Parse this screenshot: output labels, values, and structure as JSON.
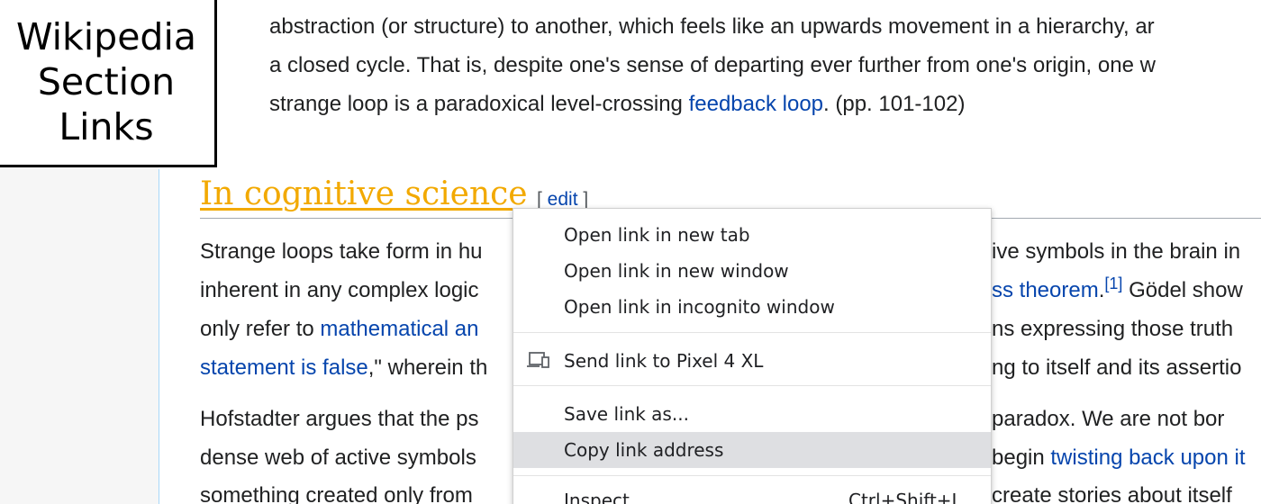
{
  "badge": {
    "line1": "Wikipedia",
    "line2": "Section",
    "line3": "Links"
  },
  "intro": {
    "line1": "abstraction (or structure) to another, which feels like an upwards movement in a hierarchy, ar",
    "line2": "a closed cycle. That is, despite one's sense of departing ever further from one's origin, one w",
    "line3_a": "strange loop is a paradoxical level-crossing ",
    "line3_link": "feedback loop",
    "line3_b": ". (pp. 101-102)"
  },
  "section": {
    "heading": "In cognitive science",
    "edit_open": "[ ",
    "edit_label": "edit",
    "edit_close": " ]"
  },
  "para1": {
    "l1a": "Strange loops take form in hu",
    "l1b": "ive symbols in the brain in",
    "l2a": "inherent in any complex logic",
    "l2link": "ss theorem",
    "l2dot": ".",
    "l2sup": "[1]",
    "l2c": " Gödel show",
    "l3a": "only refer to ",
    "l3link": "mathematical an",
    "l3b": "ns expressing those truth",
    "l4link": "statement is false",
    "l4a": ",\" wherein th",
    "l4b": "ng to itself and its assertio"
  },
  "para2": {
    "l1a": "Hofstadter argues that the ps",
    "l1b": " paradox. We are not bor",
    "l2a": "dense web of active symbols",
    "l2b": "begin ",
    "l2link": "twisting back upon it",
    "l3a": "something created only from ",
    "l3b": "create stories about itself"
  },
  "context_menu": {
    "open_new_tab": "Open link in new tab",
    "open_new_window": "Open link in new window",
    "open_incognito": "Open link in incognito window",
    "send_to_device": "Send link to Pixel 4 XL",
    "save_link_as": "Save link as...",
    "copy_link_address": "Copy link address",
    "inspect": "Inspect",
    "inspect_shortcut": "Ctrl+Shift+I",
    "send_icon": "device-icon",
    "highlight_color": "#dedfe2"
  },
  "colors": {
    "link": "#0645ad",
    "heading": "#f2a900",
    "text": "#202122"
  }
}
